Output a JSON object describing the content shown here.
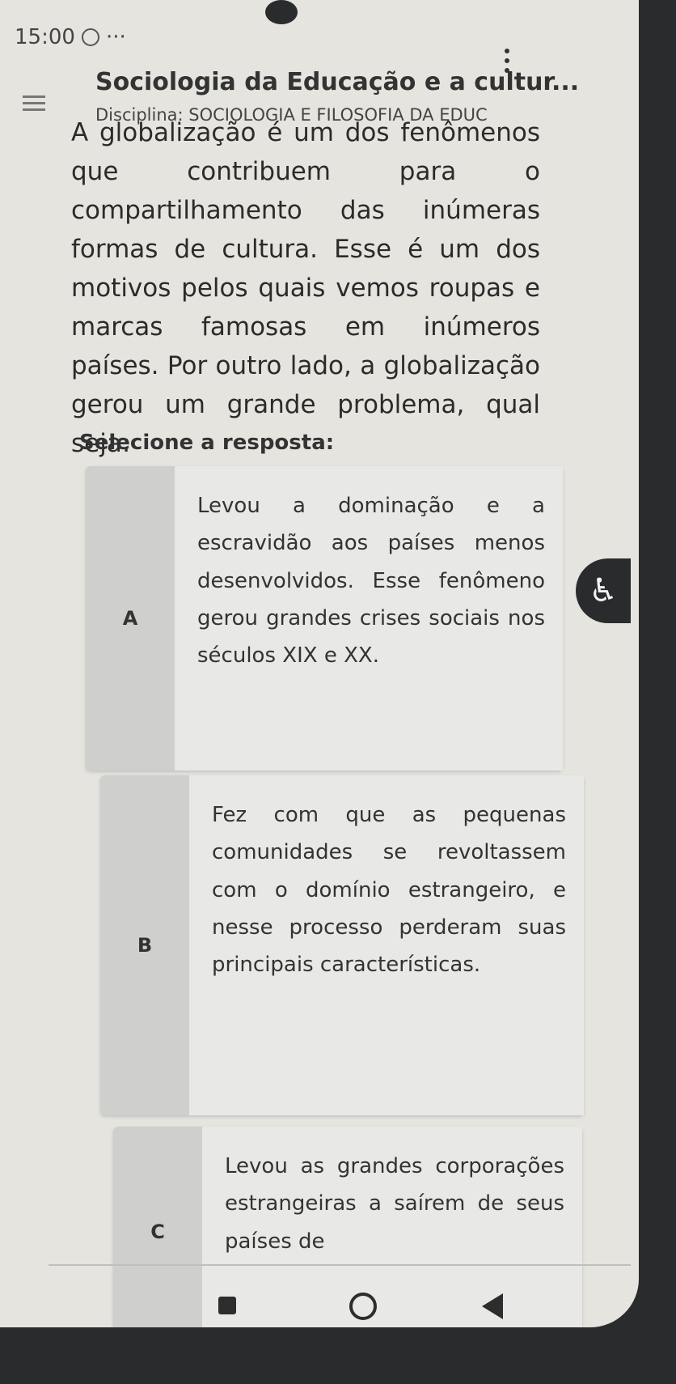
{
  "status_bar": {
    "time": "15:00",
    "extra": "···"
  },
  "header": {
    "title": "Sociologia da Educação e a cultur...",
    "subtitle": "Disciplina: SOCIOLOGIA E FILOSOFIA DA EDUC"
  },
  "question": {
    "text": "A globalização é um dos fenômenos que contribuem para o compartilhamento das inúmeras formas de cultura. Esse é um dos motivos pelos quais vemos roupas e marcas famosas em inúmeros países. Por outro lado, a globalização gerou um grande problema, qual seja:",
    "prompt": "Selecione a resposta:"
  },
  "options": [
    {
      "letter": "A",
      "text": "Levou a dominação e a escravidão aos países menos desenvolvidos. Esse fenômeno gerou grandes crises sociais nos séculos XIX e XX."
    },
    {
      "letter": "B",
      "text": "Fez com que as pequenas comunidades se revoltassem com o domínio estrangeiro, e nesse processo perderam suas principais características."
    },
    {
      "letter": "C",
      "text": "Levou as grandes corporações estrangeiras a saírem de seus países de"
    }
  ],
  "icons": {
    "menu": "menu-icon",
    "more": "more-vertical-icon",
    "accessibility": "accessibility-icon",
    "nav_recent": "recent-apps-icon",
    "nav_home": "home-icon",
    "nav_back": "back-icon"
  }
}
